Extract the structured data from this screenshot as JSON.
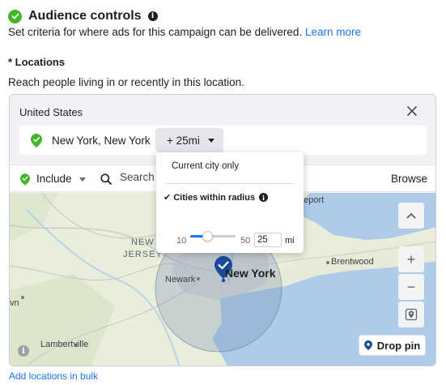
{
  "header": {
    "title": "Audience controls",
    "description": "Set criteria for where ads for this campaign can be delivered.",
    "learn_more": "Learn more"
  },
  "locations": {
    "label": "* Locations",
    "subtitle": "Reach people living in or recently in this location.",
    "country": "United States",
    "selected": {
      "name": "New York, New York",
      "radius_label": "+ 25mi"
    },
    "include_label": "Include",
    "search_placeholder": "Search",
    "browse_label": "Browse",
    "bulk_link": "Add locations in bulk"
  },
  "radius_dropdown": {
    "option_current_city": "Current city only",
    "option_cities_within": "Cities within radius",
    "check_mark": "✔",
    "slider_min": "10",
    "slider_max": "50",
    "slider_value_fraction": 0.375,
    "radius_value": "25",
    "unit": "mi"
  },
  "map": {
    "labels": {
      "new_jersey_1": "NEW",
      "new_jersey_2": "JERSEY",
      "newark": "Newark",
      "new_york": "New York",
      "bridgeport": "geport",
      "brentwood": "Brentwood",
      "lambertville": "Lambertville",
      "left_edge": "vn"
    },
    "zoom_in": "+",
    "zoom_out": "−",
    "drop_pin": "Drop pin"
  },
  "icons": {
    "check": "check-circle-icon",
    "info": "info-icon",
    "close": "close-icon",
    "pin": "location-pin-icon",
    "search": "search-icon",
    "locate": "locate-icon",
    "chevron_up": "chevron-up-icon"
  },
  "colors": {
    "accent": "#1877f2",
    "success": "#42b72a",
    "pin_blue": "#1a4a99"
  }
}
